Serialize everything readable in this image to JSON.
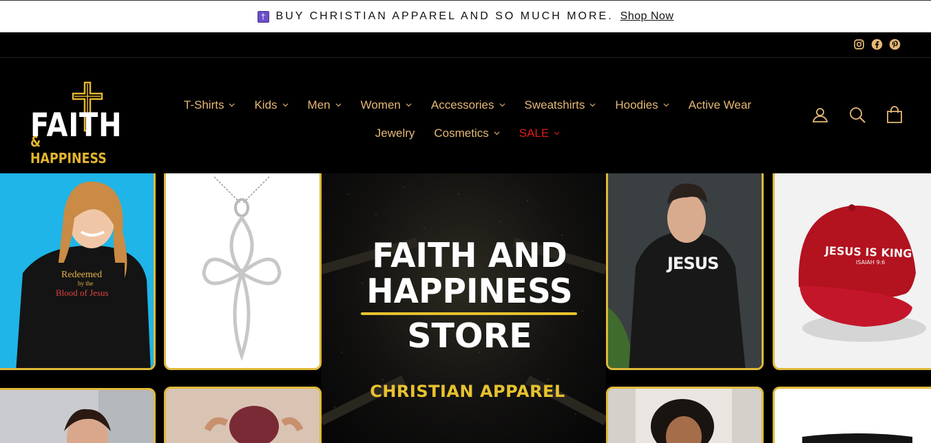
{
  "announcement": {
    "icon": "latin-cross-icon",
    "text": "BUY CHRISTIAN APPAREL AND SO MUCH MORE.",
    "link": "Shop Now"
  },
  "social": {
    "icons": [
      "instagram-icon",
      "facebook-icon",
      "pinterest-icon"
    ],
    "color": "#e6b876"
  },
  "logo": {
    "word": "FAITH",
    "sub": "& HAPPINESS",
    "accent": "#e3b52f"
  },
  "nav": {
    "row1": [
      {
        "label": "T-Shirts",
        "dropdown": true
      },
      {
        "label": "Kids",
        "dropdown": true
      },
      {
        "label": "Men",
        "dropdown": true
      },
      {
        "label": "Women",
        "dropdown": true
      },
      {
        "label": "Accessories",
        "dropdown": true
      },
      {
        "label": "Sweatshirts",
        "dropdown": true
      },
      {
        "label": "Hoodies",
        "dropdown": true
      },
      {
        "label": "Active Wear",
        "dropdown": false
      }
    ],
    "row2": [
      {
        "label": "Jewelry",
        "dropdown": false
      },
      {
        "label": "Cosmetics",
        "dropdown": true
      },
      {
        "label": "SALE",
        "dropdown": true
      }
    ],
    "color": "#e6b876",
    "sale_color": "#e11b1b"
  },
  "header_icons": [
    "account-icon",
    "search-icon",
    "cart-icon"
  ],
  "hero": {
    "title_line1": "FAITH AND",
    "title_line2": "HAPPINESS",
    "title_line3": "STORE",
    "subtitle": "CHRISTIAN APPAREL",
    "accent": "#e6c22e",
    "tiles": [
      {
        "name": "woman-hoodie-tile",
        "text1": "Redeemed",
        "text2": "by the",
        "text3": "Blood of Jesus"
      },
      {
        "name": "cross-necklace-tile"
      },
      {
        "name": "man-hoodie-tile",
        "text": "JESUS"
      },
      {
        "name": "red-cap-tile",
        "text1": "JESUS IS KING",
        "text2": "ISAIAH 9:6"
      },
      {
        "name": "woman-earrings-tile"
      },
      {
        "name": "man-beanie-tile"
      },
      {
        "name": "woman-portrait-tile"
      },
      {
        "name": "mug-tile"
      }
    ]
  }
}
